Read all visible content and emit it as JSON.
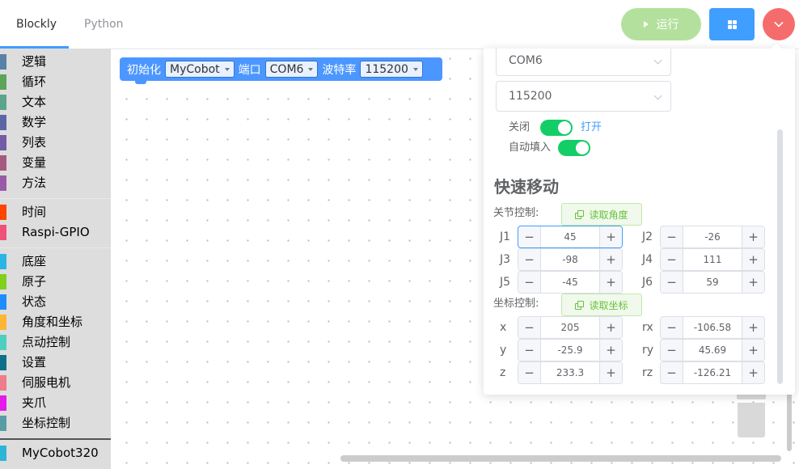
{
  "tabs": [
    "Blockly",
    "Python"
  ],
  "header": {
    "run_label": "运行"
  },
  "toolbox": {
    "categories": [
      {
        "label": "逻辑",
        "color": "#5b80a5"
      },
      {
        "label": "循环",
        "color": "#5ba55b"
      },
      {
        "label": "文本",
        "color": "#5ba58c"
      },
      {
        "label": "数学",
        "color": "#5b67a5"
      },
      {
        "label": "列表",
        "color": "#745ba5"
      },
      {
        "label": "变量",
        "color": "#a55b80"
      },
      {
        "label": "方法",
        "color": "#995ba5"
      },
      {
        "label": "时间",
        "color": "#ff4500"
      },
      {
        "label": "Raspi-GPIO",
        "color": "#f0507a"
      },
      {
        "label": "底座",
        "color": "#29b6e6"
      },
      {
        "label": "原子",
        "color": "#7fd11b"
      },
      {
        "label": "状态",
        "color": "#1f8cff"
      },
      {
        "label": "角度和坐标",
        "color": "#ffb534"
      },
      {
        "label": "点动控制",
        "color": "#4ecfc0"
      },
      {
        "label": "设置",
        "color": "#0e6f8a"
      },
      {
        "label": "伺服电机",
        "color": "#f07b8a"
      },
      {
        "label": "夹爪",
        "color": "#e41bea"
      },
      {
        "label": "坐标控制",
        "color": "#5a9ca6"
      },
      {
        "label": "MyCobot320",
        "color": "#2cb5d6"
      }
    ]
  },
  "block": {
    "init_label": "初始化",
    "robot": "MyCobot",
    "port_label": "端口",
    "port": "COM6",
    "baud_label": "波特率",
    "baud": "115200"
  },
  "panel": {
    "port_select": "COM6",
    "baud_select": "115200",
    "switch_off_label": "关闭",
    "switch_on_label": "打开",
    "autofill_label": "自动填入",
    "title": "快速移动",
    "joint_label": "关节控制:",
    "read_angles": "读取角度",
    "coord_label": "坐标控制:",
    "read_coords": "读取坐标",
    "joints": [
      {
        "name": "J1",
        "value": "45"
      },
      {
        "name": "J2",
        "value": "-26"
      },
      {
        "name": "J3",
        "value": "-98"
      },
      {
        "name": "J4",
        "value": "111"
      },
      {
        "name": "J5",
        "value": "-45"
      },
      {
        "name": "J6",
        "value": "59"
      }
    ],
    "coords": [
      {
        "name": "x",
        "value": "205"
      },
      {
        "name": "rx",
        "value": "-106.58"
      },
      {
        "name": "y",
        "value": "-25.9"
      },
      {
        "name": "ry",
        "value": "45.69"
      },
      {
        "name": "z",
        "value": "233.3"
      },
      {
        "name": "rz",
        "value": "-126.21"
      }
    ],
    "dec_symbol": "−",
    "inc_symbol": "+"
  }
}
